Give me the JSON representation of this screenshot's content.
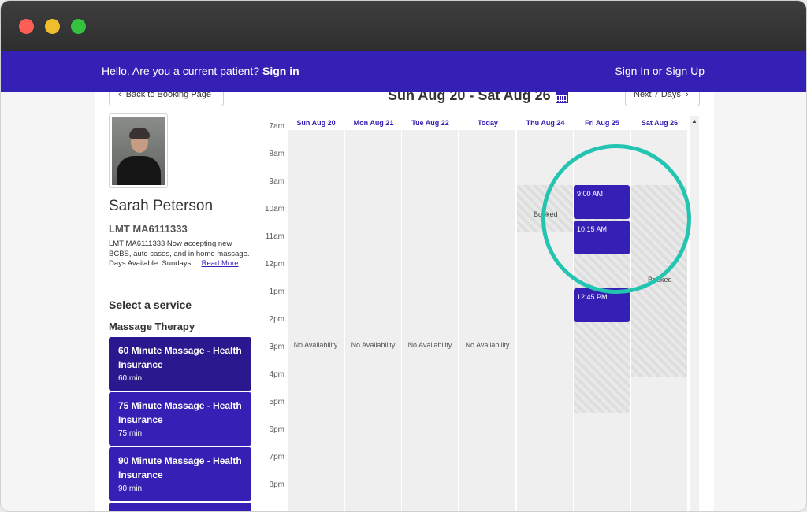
{
  "header": {
    "hello_text": "Hello. Are you a current patient?",
    "signin_label": "Sign in",
    "signup_label": "Sign In or Sign Up"
  },
  "nav": {
    "back_label": "Back to Booking Page",
    "next_label": "Next 7 Days",
    "range_title": "Sun Aug 20 - Sat Aug 26"
  },
  "provider": {
    "name": "Sarah Peterson",
    "license": "LMT MA6111333",
    "bio": "LMT MA6111333 Now accepting new BCBS, auto cases, and in home massage. Days Available: Sundays,...",
    "read_more": "Read More"
  },
  "services": {
    "title": "Select a service",
    "category": "Massage Therapy",
    "items": [
      {
        "title": "60 Minute Massage - Health Insurance",
        "duration": "60 min"
      },
      {
        "title": "75 Minute Massage - Health Insurance",
        "duration": "75 min"
      },
      {
        "title": "90 Minute Massage - Health Insurance",
        "duration": "90 min"
      }
    ]
  },
  "calendar": {
    "hours": [
      "7am",
      "8am",
      "9am",
      "10am",
      "11am",
      "12pm",
      "1pm",
      "2pm",
      "3pm",
      "4pm",
      "5pm",
      "6pm",
      "7pm",
      "8pm"
    ],
    "days": [
      "Sun Aug 20",
      "Mon Aug 21",
      "Tue Aug 22",
      "Today",
      "Thu Aug 24",
      "Fri Aug 25",
      "Sat Aug 26"
    ],
    "no_availability": "No Availability",
    "booked_label": "Booked",
    "slots": [
      "9:00 AM",
      "10:15 AM",
      "12:45 PM"
    ]
  },
  "colors": {
    "brand": "#3420b4",
    "highlight": "#23c4b0"
  }
}
